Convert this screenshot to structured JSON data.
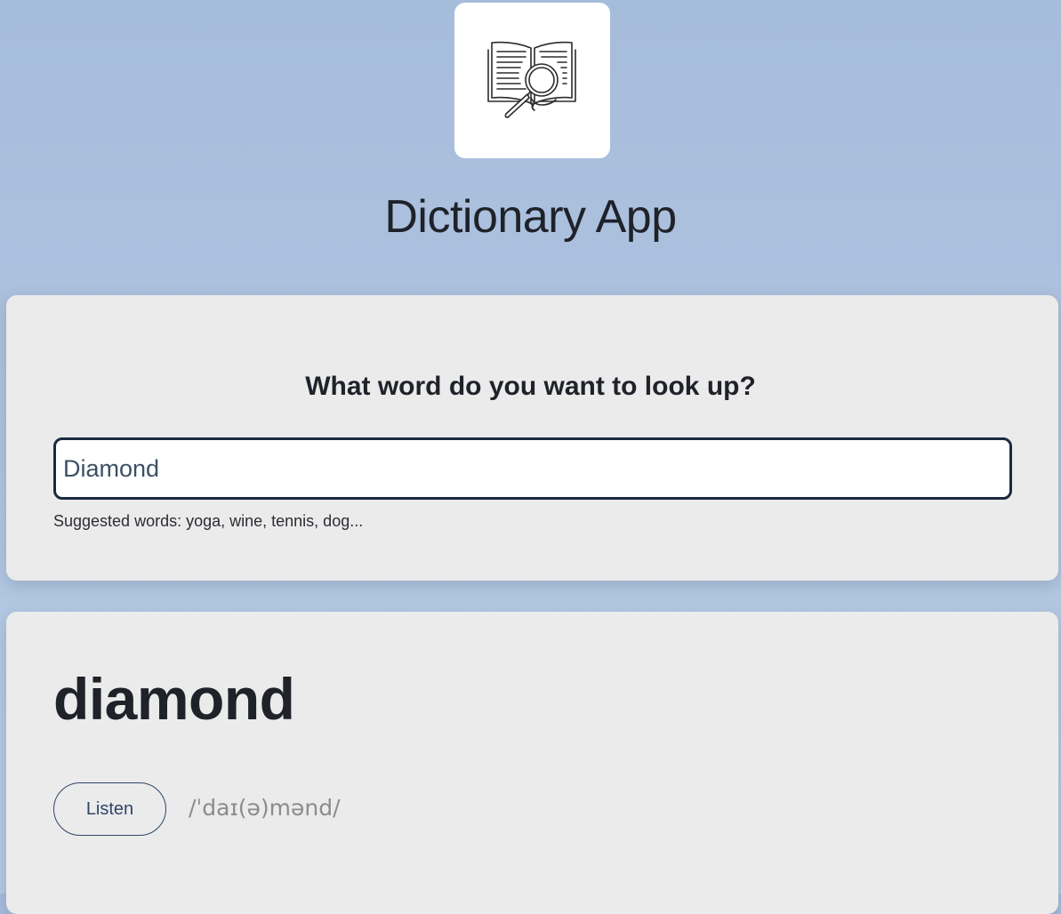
{
  "logo": {
    "icon": "book-magnifier-icon"
  },
  "header": {
    "title": "Dictionary App"
  },
  "search": {
    "prompt": "What word do you want to look up?",
    "value": "Diamond",
    "suggestions": "Suggested words: yoga, wine, tennis, dog..."
  },
  "result": {
    "word": "diamond",
    "listen_label": "Listen",
    "phonetic": "/ˈdaɪ(ə)mənd/"
  },
  "colors": {
    "background": "#a6bcdb",
    "card": "#ebebeb",
    "input_border": "#1c2940",
    "accent": "#2f4566",
    "phonetic": "#8c8c8c"
  }
}
